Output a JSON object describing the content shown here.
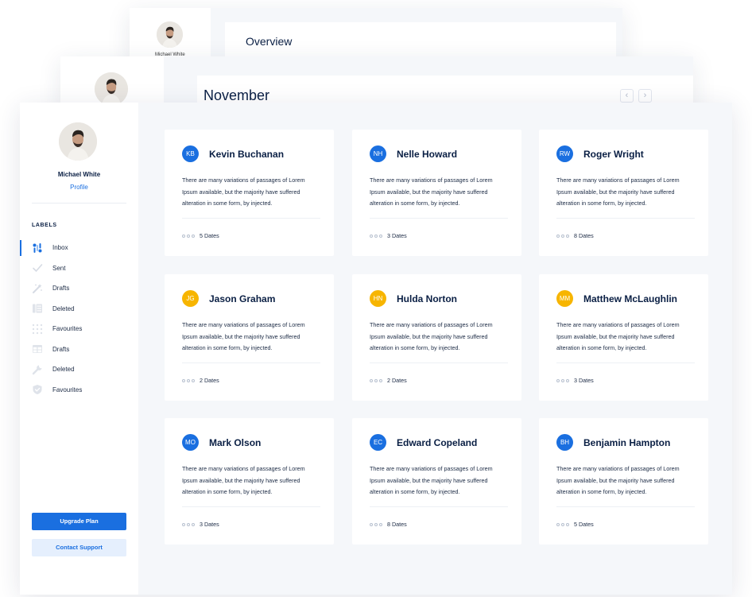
{
  "background_windows": [
    {
      "header_title": "Overview",
      "profile_name": "Michael White"
    },
    {
      "header_title": "November",
      "pager": {
        "prev": "‹",
        "next": "›"
      }
    }
  ],
  "sidebar": {
    "user_name": "Michael White",
    "profile_link": "Profile",
    "labels_heading": "LABELS",
    "items": [
      {
        "label": "Inbox",
        "icon": "inbox-icon",
        "active": true
      },
      {
        "label": "Sent",
        "icon": "check-icon"
      },
      {
        "label": "Drafts",
        "icon": "magic-icon"
      },
      {
        "label": "Deleted",
        "icon": "layout-icon"
      },
      {
        "label": "Favourites",
        "icon": "grid-icon"
      },
      {
        "label": "Drafts",
        "icon": "table-icon"
      },
      {
        "label": "Deleted",
        "icon": "wrench-icon"
      },
      {
        "label": "Favourites",
        "icon": "shield-icon"
      }
    ],
    "upgrade_button": "Upgrade Plan",
    "support_button": "Contact Support"
  },
  "colors": {
    "accent": "#1a6fe0",
    "badge_blue": "#1a6fe0",
    "badge_yellow": "#f7b500"
  },
  "cards": [
    {
      "initials": "KB",
      "name": "Kevin Buchanan",
      "color": "blue",
      "text": "There are many variations of passages of Lorem Ipsum available, but the majority have suffered alteration in some form, by injected.",
      "dates": "5 Dates"
    },
    {
      "initials": "NH",
      "name": "Nelle Howard",
      "color": "blue",
      "text": "There are many variations of passages of Lorem Ipsum available, but the majority have suffered alteration in some form, by injected.",
      "dates": "3 Dates"
    },
    {
      "initials": "RW",
      "name": "Roger Wright",
      "color": "blue",
      "text": "There are many variations of passages of Lorem Ipsum available, but the majority have suffered alteration in some form, by injected.",
      "dates": "8 Dates"
    },
    {
      "initials": "JG",
      "name": "Jason Graham",
      "color": "yellow",
      "text": "There are many variations of passages of Lorem Ipsum available, but the majority have suffered alteration in some form, by injected.",
      "dates": "2 Dates"
    },
    {
      "initials": "HN",
      "name": "Hulda Norton",
      "color": "yellow",
      "text": "There are many variations of passages of Lorem Ipsum available, but the majority have suffered alteration in some form, by injected.",
      "dates": "2 Dates"
    },
    {
      "initials": "MM",
      "name": "Matthew McLaughlin",
      "color": "yellow",
      "text": "There are many variations of passages of Lorem Ipsum available, but the majority have suffered alteration in some form, by injected.",
      "dates": "3 Dates"
    },
    {
      "initials": "MO",
      "name": "Mark Olson",
      "color": "blue",
      "text": "There are many variations of passages of Lorem Ipsum available, but the majority have suffered alteration in some form, by injected.",
      "dates": "3 Dates"
    },
    {
      "initials": "EC",
      "name": "Edward Copeland",
      "color": "blue",
      "text": "There are many variations of passages of Lorem Ipsum available, but the majority have suffered alteration in some form, by injected.",
      "dates": "8 Dates"
    },
    {
      "initials": "BH",
      "name": "Benjamin Hampton",
      "color": "blue",
      "text": "There are many variations of passages of Lorem Ipsum available, but the majority have suffered alteration in some form, by injected.",
      "dates": "5 Dates"
    }
  ]
}
